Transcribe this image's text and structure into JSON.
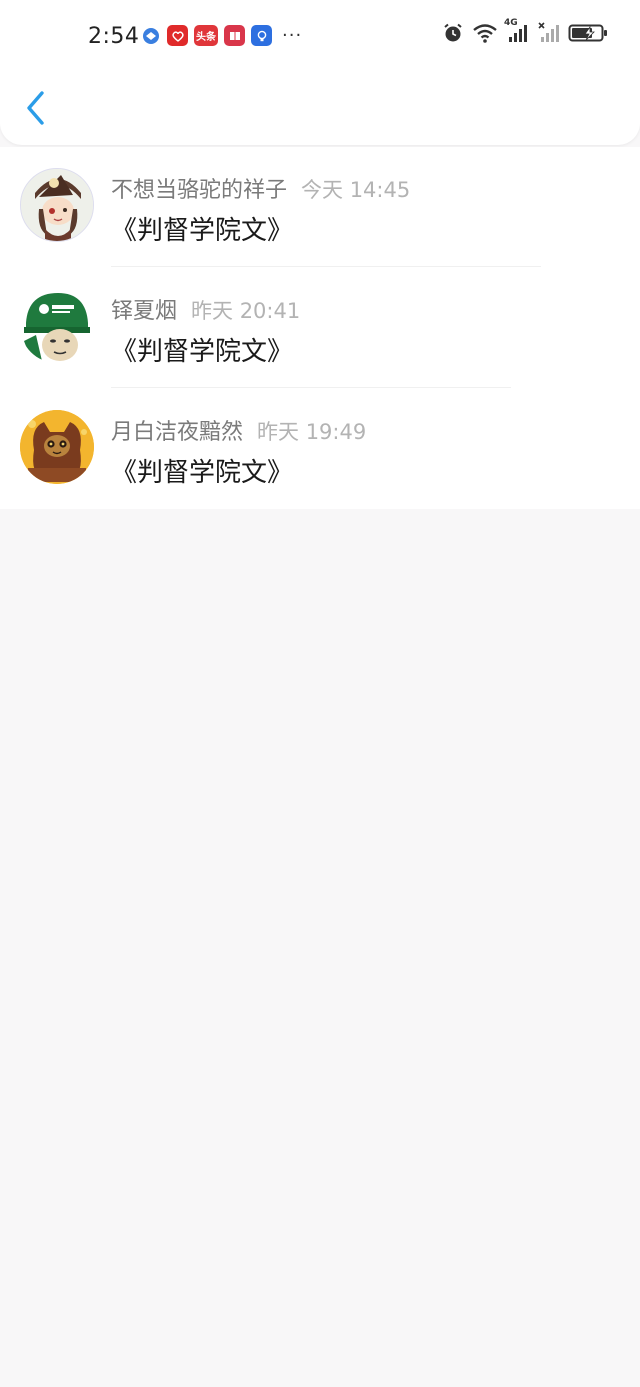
{
  "status_bar": {
    "time": "2:54",
    "dots": "···",
    "network": "4G",
    "icons_left": [
      "browser-icon",
      "gift-app-icon",
      "toutiao-icon",
      "reader-icon",
      "bulb-icon"
    ],
    "icons_left_labels": {
      "toutiao": "头条"
    },
    "icons_right": [
      "alarm-icon",
      "wifi-icon",
      "signal-icon",
      "signal-no-sim-icon",
      "battery-charging-icon"
    ]
  },
  "header": {
    "back_icon": "chevron-left-icon"
  },
  "colors": {
    "accent": "#2b9de8",
    "name": "#7a7a7a",
    "time": "#b3b3b3",
    "message": "#1a1a1a",
    "background": "#f8f7f8"
  },
  "items": [
    {
      "name": "不想当骆驼的祥子",
      "time": "今天 14:45",
      "message": "《判督学院文》",
      "avatar": "anime-girl-avatar"
    },
    {
      "name": "铎夏烟",
      "time": "昨天 20:41",
      "message": "《判督学院文》",
      "avatar": "postal-meme-avatar"
    },
    {
      "name": "月白洁夜黯然",
      "time": "昨天 19:49",
      "message": "《判督学院文》",
      "avatar": "cat-character-avatar"
    }
  ]
}
